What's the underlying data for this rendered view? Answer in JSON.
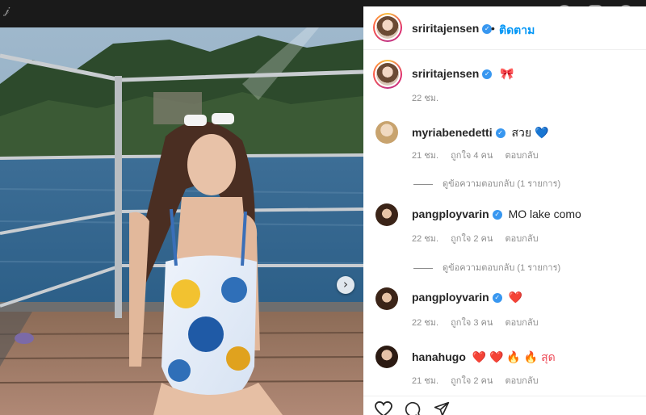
{
  "post_author": {
    "username": "sriritajensen",
    "follow_label": "ติดตาม",
    "dot": "•"
  },
  "caption": {
    "username": "sriritajensen",
    "text": "🎀",
    "time": "22 ชม."
  },
  "comments": [
    {
      "username": "myriabenedetti",
      "verified": true,
      "text": "สวย 💙",
      "time": "21 ชม.",
      "likes": "ถูกใจ 4 คน",
      "reply_label": "ตอบกลับ",
      "view_replies": "ดูข้อความตอบกลับ (1 รายการ)"
    },
    {
      "username": "pangployvarin",
      "verified": true,
      "text": "MO lake como",
      "time": "22 ชม.",
      "likes": "ถูกใจ 2 คน",
      "reply_label": "ตอบกลับ",
      "view_replies": "ดูข้อความตอบกลับ (1 รายการ)"
    },
    {
      "username": "pangployvarin",
      "verified": true,
      "text": "❤️",
      "time": "22 ชม.",
      "likes": "ถูกใจ 3 คน",
      "reply_label": "ตอบกลับ"
    },
    {
      "username": "hanahugo",
      "verified": false,
      "text": "❤️ ❤️ 🔥 🔥 สุด",
      "time": "21 ชม.",
      "likes": "ถูกใจ 2 คน",
      "reply_label": "ตอบกลับ"
    }
  ],
  "icons": {
    "verified": "verified-badge-icon",
    "next": "chevron-right-icon",
    "like": "heart-outline-icon",
    "comment": "comment-bubble-icon",
    "share": "paper-plane-icon"
  },
  "symbols": {
    "check": "✓",
    "next": "›"
  },
  "colors": {
    "accent": "#0095f6",
    "verified": "#3897f0",
    "text": "#262626",
    "meta": "#8e8e8e"
  }
}
